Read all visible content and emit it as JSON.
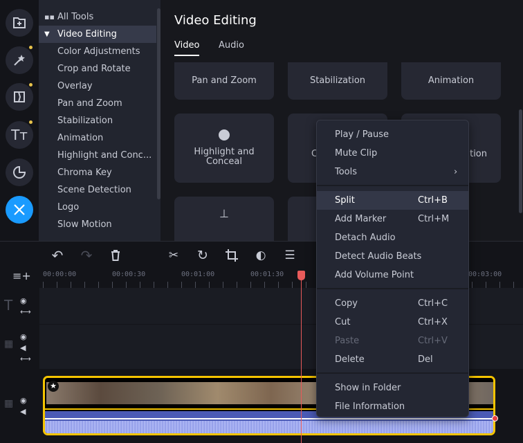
{
  "rail": {
    "items": [
      {
        "icon": "add-folder-icon",
        "active": false,
        "dot": false
      },
      {
        "icon": "magic-wand-icon",
        "active": false,
        "dot": true
      },
      {
        "icon": "transitions-icon",
        "active": false,
        "dot": true
      },
      {
        "icon": "titles-icon",
        "active": false,
        "dot": true
      },
      {
        "icon": "stickers-icon",
        "active": false,
        "dot": false
      },
      {
        "icon": "tools-icon",
        "active": true,
        "dot": false
      }
    ],
    "accent": "#1a9bff",
    "dot_color": "#e8c34b"
  },
  "sidebar": {
    "all_tools": "All Tools",
    "section": "Video Editing",
    "items": [
      "Color Adjustments",
      "Crop and Rotate",
      "Overlay",
      "Pan and Zoom",
      "Stabilization",
      "Animation",
      "Highlight and Conc...",
      "Chroma Key",
      "Scene Detection",
      "Logo",
      "Slow Motion"
    ]
  },
  "main": {
    "title": "Video Editing",
    "tabs": [
      {
        "label": "Video",
        "active": true
      },
      {
        "label": "Audio",
        "active": false
      }
    ],
    "cards": [
      "Pan and Zoom",
      "Stabilization",
      "Animation",
      "Highlight and Conceal",
      "C",
      "tion"
    ]
  },
  "timeline": {
    "ticks": [
      "00:00:00",
      "00:00:30",
      "00:01:00",
      "00:01:30",
      "00:03:00"
    ],
    "playhead_color": "#e85a5a",
    "clip_border": "#f5c400"
  },
  "context_menu": {
    "groups": [
      [
        {
          "label": "Play / Pause"
        },
        {
          "label": "Mute Clip"
        },
        {
          "label": "Tools",
          "submenu": true
        }
      ],
      [
        {
          "label": "Split",
          "shortcut": "Ctrl+B",
          "highlighted": true
        },
        {
          "label": "Add Marker",
          "shortcut": "Ctrl+M"
        },
        {
          "label": "Detach Audio"
        },
        {
          "label": "Detect Audio Beats"
        },
        {
          "label": "Add Volume Point"
        }
      ],
      [
        {
          "label": "Copy",
          "shortcut": "Ctrl+C"
        },
        {
          "label": "Cut",
          "shortcut": "Ctrl+X"
        },
        {
          "label": "Paste",
          "shortcut": "Ctrl+V",
          "disabled": true
        },
        {
          "label": "Delete",
          "shortcut": "Del"
        }
      ],
      [
        {
          "label": "Show in Folder"
        },
        {
          "label": "File Information"
        }
      ]
    ]
  }
}
